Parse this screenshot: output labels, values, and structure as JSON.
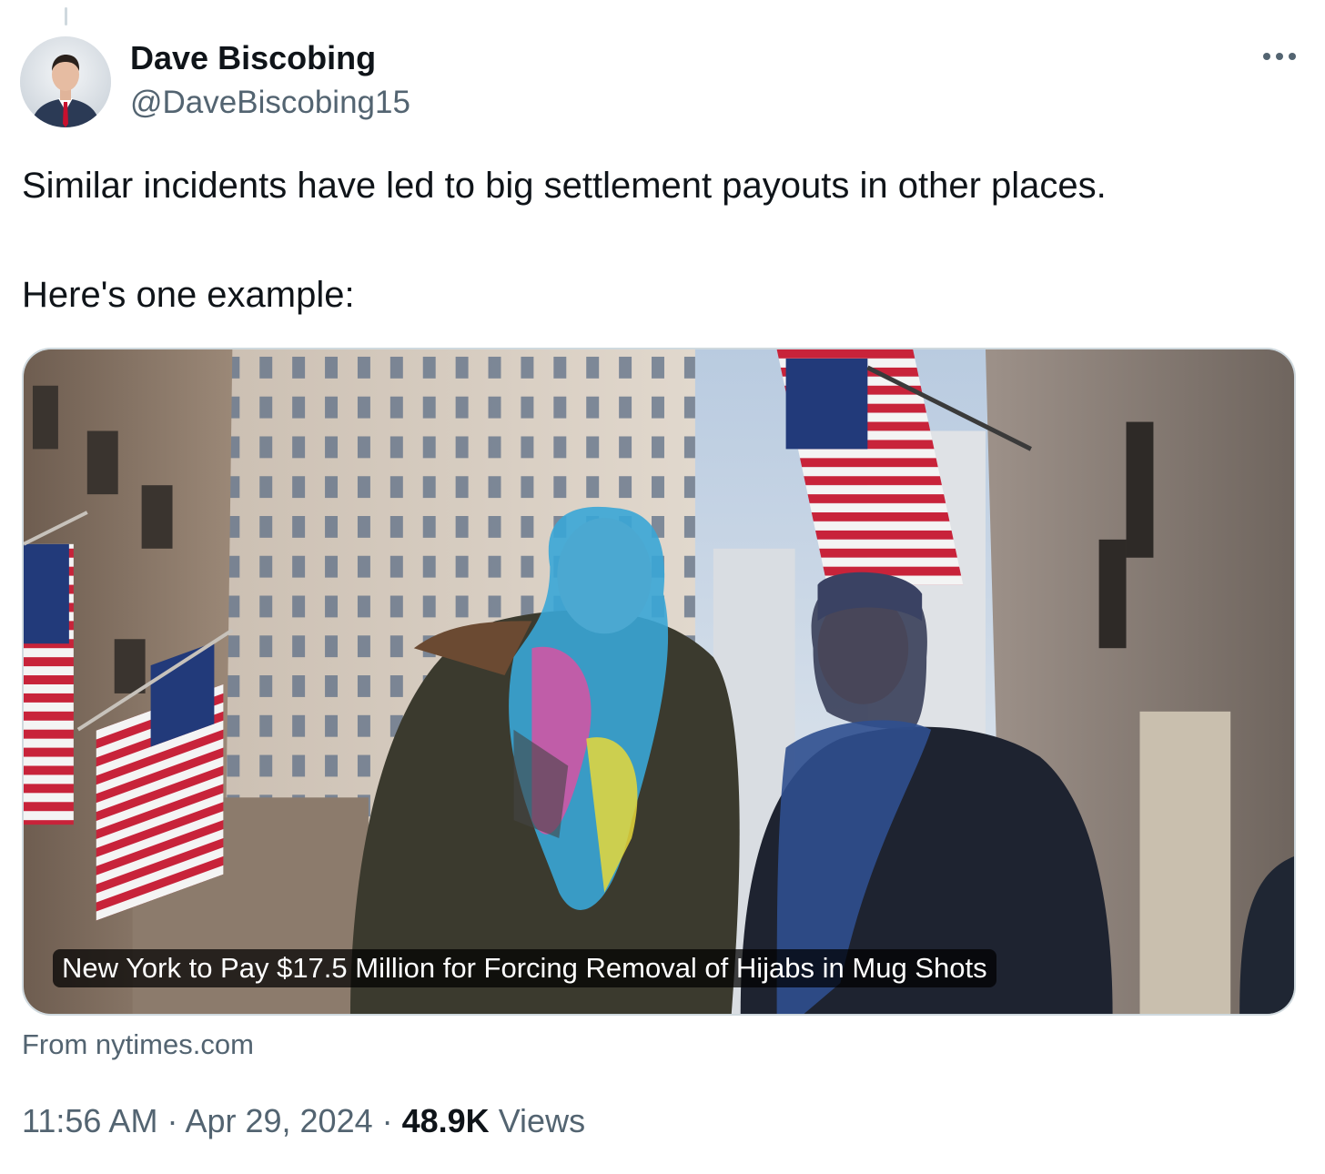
{
  "author": {
    "display_name": "Dave Biscobing",
    "handle": "@DaveBiscobing15"
  },
  "more_icon": "more-horizontal-icon",
  "tweet": {
    "text": "Similar incidents have led to big settlement payouts in other places.\n\nHere's one example:"
  },
  "card": {
    "headline": "New York to Pay $17.5 Million for Forcing Removal of Hijabs in Mug Shots",
    "source": "From nytimes.com"
  },
  "meta": {
    "time": "11:56 AM",
    "separator1": " · ",
    "date": "Apr 29, 2024",
    "separator2": " · ",
    "views_count": "48.9K",
    "views_label": " Views"
  },
  "colors": {
    "text_primary": "#0f1419",
    "text_secondary": "#536471",
    "border": "#cfd9de"
  }
}
